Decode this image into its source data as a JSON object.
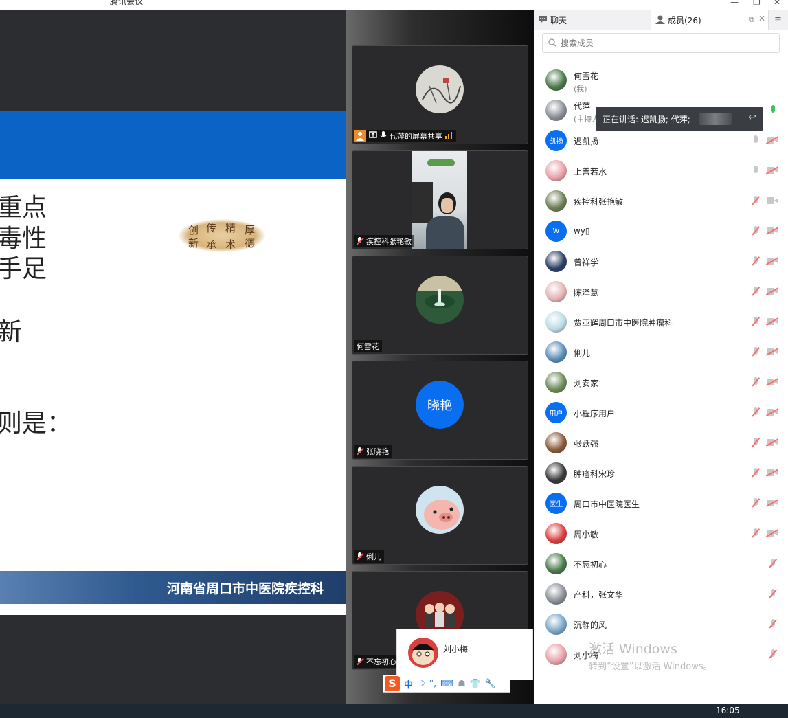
{
  "window": {
    "title": "腾讯会议"
  },
  "slide": {
    "lines": [
      "重点",
      "毒性",
      "手足",
      "新",
      "则是："
    ],
    "seal_chars": [
      "创",
      "传",
      "精",
      "厚",
      "新",
      "承",
      "术",
      "德"
    ],
    "footer": "河南省周口市中医院疾控科"
  },
  "tiles": [
    {
      "name": "代萍的屏幕共享",
      "kind": "photo-ink"
    },
    {
      "name": "疾控科张艳敏",
      "kind": "camera"
    },
    {
      "name": "何雪花",
      "kind": "photo-fountain"
    },
    {
      "name": "张晓艳",
      "kind": "letter",
      "avatar_text": "晓艳"
    },
    {
      "name": "俐儿",
      "kind": "photo-pig"
    },
    {
      "name": "不忘初心",
      "kind": "photo-cartoon"
    }
  ],
  "panel": {
    "tab_chat": "聊天",
    "tab_members": "成员(26)",
    "search_placeholder": "搜索成员",
    "speaking": "正在讲话: 迟凯扬; 代萍;",
    "members": [
      {
        "name": "何雪花",
        "sub": "(我)",
        "av": "photo"
      },
      {
        "name": "代萍",
        "sub": "(主持人",
        "av": "photo"
      },
      {
        "name": "迟凯扬",
        "av": "text",
        "av_text": "凯扬"
      },
      {
        "name": "上善若水",
        "av": "photo"
      },
      {
        "name": "疾控科张艳敏",
        "av": "photo"
      },
      {
        "name": "wy\u0000",
        "av": "text",
        "av_text": "W"
      },
      {
        "name": "曾祥学",
        "av": "photo"
      },
      {
        "name": "陈泽慧",
        "av": "photo"
      },
      {
        "name": "贾亚辉周口市中医院肿瘤科",
        "av": "photo"
      },
      {
        "name": "俐儿",
        "av": "photo"
      },
      {
        "name": "刘安家",
        "av": "photo"
      },
      {
        "name": "小程序用户",
        "av": "text",
        "av_text": "用户"
      },
      {
        "name": "张跃强",
        "av": "photo"
      },
      {
        "name": "肿瘤科宋珍",
        "av": "photo"
      },
      {
        "name": "周口市中医院医生",
        "av": "text",
        "av_text": "医生"
      },
      {
        "name": "周小敏",
        "av": "photo"
      },
      {
        "name": "不忘初心",
        "av": "photo"
      },
      {
        "name": "产科，张文华",
        "av": "photo"
      },
      {
        "name": "沉静的风",
        "av": "photo"
      },
      {
        "name": "刘小梅",
        "av": "photo"
      }
    ]
  },
  "popup": {
    "name": "刘小梅"
  },
  "watermark": {
    "line1": "激活 Windows",
    "line2": "转到“设置”以激活 Windows。"
  },
  "ime": {
    "mode": "中"
  },
  "taskbar": {
    "time": "16:05"
  }
}
